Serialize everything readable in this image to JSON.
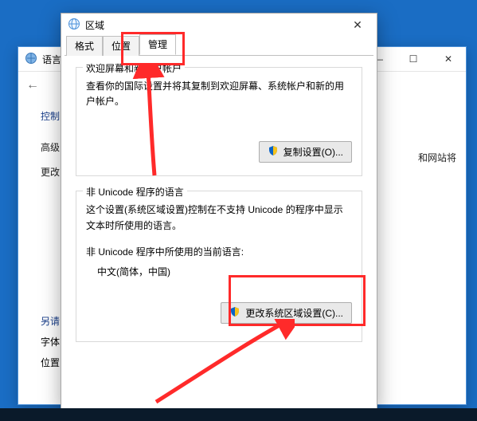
{
  "back_window": {
    "title": "语言",
    "nav_back": "←",
    "side": {
      "item0": "控制",
      "item1": "高级",
      "item2": "更改"
    },
    "link1": "另请",
    "link2": "字体",
    "link3": "位置",
    "overflow_text": "和网站将"
  },
  "dialog": {
    "title": "区域",
    "tabs": {
      "t0": "格式",
      "t1": "位置",
      "t2": "管理"
    },
    "group1": {
      "legend": "欢迎屏幕和新用户帐户",
      "desc": "查看你的国际设置并将其复制到欢迎屏幕、系统帐户和新的用户帐户。",
      "btn": "复制设置(O)..."
    },
    "group2": {
      "legend": "非 Unicode 程序的语言",
      "desc": "这个设置(系统区域设置)控制在不支持 Unicode 的程序中显示文本时所使用的语言。",
      "sublabel": "非 Unicode 程序中所使用的当前语言:",
      "value": "中文(简体，中国)",
      "btn": "更改系统区域设置(C)..."
    },
    "close": "✕"
  },
  "window_buttons": {
    "min": "—",
    "max": "☐",
    "close": "✕"
  }
}
